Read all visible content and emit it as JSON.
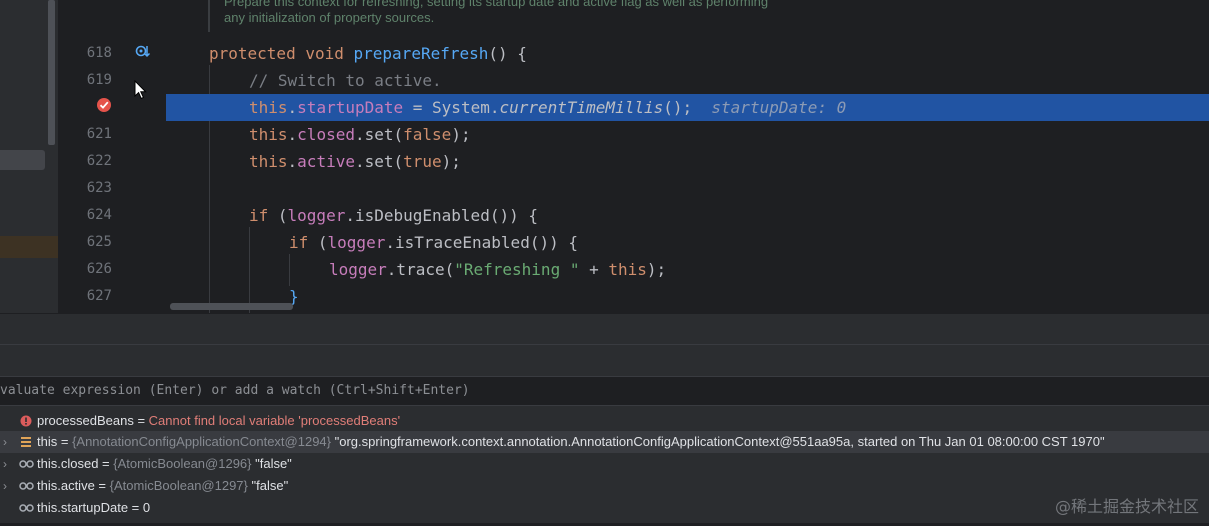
{
  "editor": {
    "doc_comment": [
      "Prepare this context for refreshing, setting its startup date and active flag as well as performing",
      "any initialization of property sources."
    ],
    "lines": [
      {
        "num": "618"
      },
      {
        "num": "619"
      },
      {
        "num": ""
      },
      {
        "num": "621"
      },
      {
        "num": "622"
      },
      {
        "num": "623"
      },
      {
        "num": "624"
      },
      {
        "num": "625"
      },
      {
        "num": "626"
      },
      {
        "num": "627"
      }
    ],
    "code": {
      "l618_kw1": "protected",
      "l618_kw2": "void",
      "l618_fn": "prepareRefresh",
      "l618_rest": "() {",
      "l619_comment": "// Switch to active.",
      "l620_this": "this",
      "l620_field": "startupDate",
      "l620_mid": " = System.",
      "l620_call": "currentTimeMillis",
      "l620_end": "();",
      "l620_hint": "startupDate: 0",
      "l621_this": "this",
      "l621_field": "closed",
      "l621_mid": ".set(",
      "l621_kw": "false",
      "l621_end": ");",
      "l622_this": "this",
      "l622_field": "active",
      "l622_mid": ".set(",
      "l622_kw": "true",
      "l622_end": ");",
      "l624_kw": "if",
      "l624_a": " (",
      "l624_field": "logger",
      "l624_b": ".isDebugEnabled()) {",
      "l625_kw": "if",
      "l625_a": " (",
      "l625_field": "logger",
      "l625_b": ".isTraceEnabled()) {",
      "l626_field": "logger",
      "l626_a": ".trace(",
      "l626_str": "\"Refreshing \"",
      "l626_b": " + ",
      "l626_this": "this",
      "l626_end": ");",
      "l627": "}"
    }
  },
  "debugger": {
    "eval_placeholder": "valuate expression (Enter) or add a watch (Ctrl+Shift+Enter)",
    "variables": [
      {
        "name": "processedBeans",
        "eq": " = ",
        "value": "Cannot find local variable 'processedBeans'",
        "icon": "error-icon"
      },
      {
        "name": "this",
        "eq": " = ",
        "type": "{AnnotationConfigApplicationContext@1294}",
        "value": " \"org.springframework.context.annotation.AnnotationConfigApplicationContext@551aa95a, started on Thu Jan 01 08:00:00 CST 1970\"",
        "icon": "object-icon"
      },
      {
        "name": "this.closed",
        "eq": " = ",
        "type": "{AtomicBoolean@1296}",
        "value": " \"false\"",
        "icon": "watch-icon"
      },
      {
        "name": "this.active",
        "eq": " = ",
        "type": "{AtomicBoolean@1297}",
        "value": " \"false\"",
        "icon": "watch-icon"
      },
      {
        "name": "this.startupDate",
        "eq": " = ",
        "value": "0",
        "icon": "watch-icon"
      }
    ]
  },
  "watermark": "@稀土掘金技术社区",
  "colors": {
    "execution_line": "#2154a3",
    "keyword": "#cf8e6d",
    "function": "#56a8f5",
    "field": "#c77dbb",
    "string": "#6aab73",
    "error": "#e07e78"
  }
}
